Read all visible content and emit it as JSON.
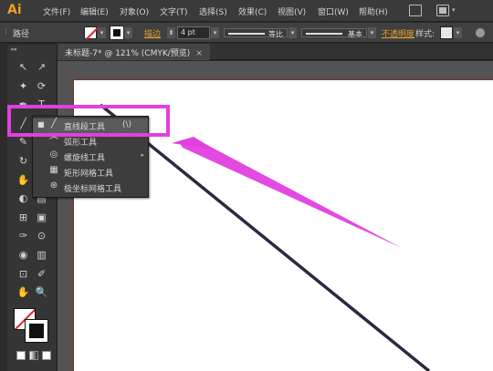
{
  "app": {
    "logo_text": "Ai"
  },
  "menubar": {
    "items": [
      {
        "label": "文件(F)"
      },
      {
        "label": "编辑(E)"
      },
      {
        "label": "对象(O)"
      },
      {
        "label": "文字(T)"
      },
      {
        "label": "选择(S)"
      },
      {
        "label": "效果(C)"
      },
      {
        "label": "视图(V)"
      },
      {
        "label": "窗口(W)"
      },
      {
        "label": "帮助(H)"
      }
    ]
  },
  "control_bar": {
    "path_label": "路径",
    "stroke_label": "描边",
    "stroke_weight": "4 pt",
    "stroke_profile": "等比",
    "brush_definition": "基本",
    "opacity_label": "不透明度",
    "style_label": "样式:"
  },
  "document_tab": {
    "title": "未标题-7* @ 121% (CMYK/预览)",
    "close_glyph": "×"
  },
  "flyout": {
    "items": [
      {
        "icon": "╱",
        "label": "直线段工具",
        "shortcut": "(\\)",
        "bullet": "■",
        "active": true
      },
      {
        "icon": "⌒",
        "label": "弧形工具",
        "shortcut": "",
        "bullet": "",
        "active": false
      },
      {
        "icon": "◎",
        "label": "螺旋线工具",
        "shortcut": "",
        "bullet": "",
        "active": false
      },
      {
        "icon": "▦",
        "label": "矩形网格工具",
        "shortcut": "",
        "bullet": "",
        "active": false
      },
      {
        "icon": "⊛",
        "label": "极坐标网格工具",
        "shortcut": "",
        "bullet": "",
        "active": false
      }
    ]
  },
  "toolbar": {
    "tools": [
      {
        "glyph": "↖"
      },
      {
        "glyph": "↗"
      },
      {
        "glyph": "✦"
      },
      {
        "glyph": "⟳"
      },
      {
        "glyph": "✒"
      },
      {
        "glyph": "T"
      },
      {
        "glyph": "╱"
      },
      {
        "glyph": "▭"
      },
      {
        "glyph": "✎"
      },
      {
        "glyph": "✂"
      },
      {
        "glyph": "↻"
      },
      {
        "glyph": "⤡"
      },
      {
        "glyph": "✋"
      },
      {
        "glyph": "⬒"
      },
      {
        "glyph": "◐"
      },
      {
        "glyph": "▤"
      },
      {
        "glyph": "⊞"
      },
      {
        "glyph": "▣"
      },
      {
        "glyph": "✑"
      },
      {
        "glyph": "⊙"
      },
      {
        "glyph": "◉"
      },
      {
        "glyph": "▥"
      },
      {
        "glyph": "⊡"
      },
      {
        "glyph": "✐"
      },
      {
        "glyph": "✋"
      },
      {
        "glyph": "🔍"
      }
    ]
  },
  "colors": {
    "highlight": "#e040e0",
    "line_stroke": "#2a2a40",
    "app_bg": "#2b2b2b",
    "artboard": "#ffffff"
  }
}
